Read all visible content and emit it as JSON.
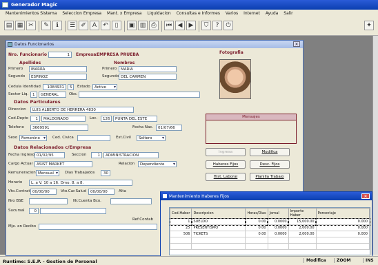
{
  "app": {
    "title": "Generador Magic"
  },
  "menu": [
    "Mantenimientos Sistema",
    "Seleccion Empresa",
    "Mant. x Empresa",
    "Liquidacion",
    "Consultas e Informes",
    "Varios",
    "Internet",
    "Ayuda",
    "Salir"
  ],
  "window": {
    "title": "Datos Funcionarios"
  },
  "header": {
    "nro_label": "Nro. Funcionario",
    "nro_value": "1",
    "empresa_label": "Empresa:",
    "empresa_value": "EMPRESA PRUEBA",
    "foto_label": "Fotografia"
  },
  "names": {
    "apellidos_label": "Apellidos",
    "nombres_label": "Nombres",
    "primero_label": "Primero",
    "segundo_label": "Segundo",
    "apellido1": "IBARRA",
    "apellido2": "ESPINOZ",
    "nombre1": "MARIA",
    "nombre2": "DEL CARMEN"
  },
  "cedula": {
    "label": "Cedula Identidad",
    "value": "1084931",
    "dv": "5",
    "estado_label": "Estado",
    "estado_value": "Activo"
  },
  "sector": {
    "label": "Sector Liq.",
    "code": "1",
    "value": "GENERAL",
    "obs_label": "Obs."
  },
  "particulares": {
    "title": "Datos Particulares",
    "direccion_label": "Direccion",
    "direccion_value": "LUIS ALBERTO DE HERRERA 4830",
    "coddepto_label": "Cod.Depto",
    "coddepto_code": "1",
    "coddepto_value": "MALDONADO",
    "loc_label": "Loc.",
    "loc_code": "126",
    "loc_value": "PUNTA DEL ESTE",
    "telefono_label": "Telefono",
    "telefono_value": "3669591",
    "fechanac_label": "Fecha Nac.",
    "fechanac_value": "01/07/66",
    "sexo_label": "Sexo",
    "sexo_value": "Femenino",
    "ced_civica_label": "Ced. Civica",
    "estcivil_label": "Est.Civil",
    "estcivil_value": "Soltero"
  },
  "empresa": {
    "title": "Datos Relacionados c/Empresa",
    "fecha_ingreso_label": "Fecha Ingreso",
    "fecha_ingreso_value": "01/02/95",
    "seccion_label": "Seccion",
    "seccion_code": "1",
    "seccion_value": "ADMINISTRACION",
    "cargo_label": "Cargo Actual",
    "cargo_value": "ASIST MARKET",
    "relacion_label": "Relacion",
    "relacion_value": "Dependiente",
    "remuneracion_label": "Remuneracion",
    "remuneracion_value": "Mensual",
    "dias_label": "Dias Trabajados",
    "dias_value": "30",
    "horario_label": "Horario",
    "horario_value": "L. a V. 10 a 16. Dmo. 8. a 8.",
    "vto_contrato_label": "Vto.Contrato",
    "vto_contrato_value": "00/00/00",
    "vto_salud_label": "Vto.Car.Salud",
    "vto_salud_value": "00/00/00",
    "alta_label": "Alta",
    "nro_bse_label": "Nro BSE",
    "nro_cuenta_label": "Nr.Cuenta Bco.",
    "sucursal_label": "Sucursal",
    "sucursal_value": "0",
    "ref_contable_label": "Ref.Contab",
    "mje_label": "Mje. en Recibo"
  },
  "mensajes": {
    "title": "Mensajes"
  },
  "buttons": {
    "ingresa": "Ingresa",
    "modifica": "Modifica",
    "haberes_fijos": "Haberes Fijos",
    "desc_fijos": "Desc. Fijos",
    "hist_laboral": "Hist. Laboral",
    "planilla": "Planilla Trabajo"
  },
  "dialog": {
    "title": "Mantenimiento Haberes Fijos",
    "columns": [
      "Cod.Haber",
      "Descripcion",
      "Horas/Dias",
      "Jornal",
      "Importe Haber",
      "Porcentaje"
    ],
    "rows": [
      [
        "1",
        "SUELDO",
        "0.00",
        "0.0000",
        "15,000.00",
        "0.000"
      ],
      [
        "25",
        "PRESENTISMO",
        "0.00",
        "0.0000",
        "2,000.00",
        "0.000"
      ],
      [
        "506",
        "TICKETS",
        "0.00",
        "0.0000",
        "2,000.00",
        "0.000"
      ]
    ]
  },
  "status": {
    "text": "Runtime: S.E.P. - Gestion de Personal",
    "mode": "Modifica",
    "zoom": "ZOOM",
    "ins": "INS"
  }
}
